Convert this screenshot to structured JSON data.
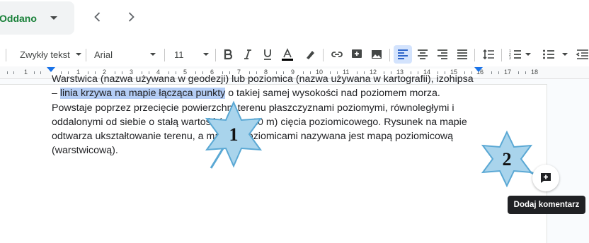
{
  "header": {
    "status_label": "Oddano"
  },
  "toolbar": {
    "style_label": "Zwykły tekst",
    "font_label": "Arial",
    "size_label": "11"
  },
  "ruler": {
    "numbers": [
      "1",
      "1",
      "2",
      "3",
      "4",
      "5",
      "6",
      "7",
      "8",
      "9",
      "10",
      "11",
      "12",
      "13",
      "14",
      "15",
      "16",
      "17",
      "18"
    ]
  },
  "document": {
    "text_before": "Warstwica (nazwa używana w geodezji) lub poziomica (nazwa używana w kartografii), izohipsa – ",
    "highlighted": "linia krzywa na mapie łącząca punkty",
    "text_after": " o takiej samej wysokości nad poziomem morza. Powstaje poprzez przecięcie powierzchni terenu płaszczyznami poziomymi, równoległymi i oddalonymi od siebie o stałą wartość (np. co 10 m) cięcia poziomicowego. Rysunek na mapie odtwarza ukształtowanie terenu, a mapa z poziomicami nazywana jest mapą poziomicową (warstwicową)."
  },
  "comment": {
    "tooltip": "Dodaj komentarz"
  },
  "callouts": {
    "first": "1",
    "second": "2",
    "fill": "#a9d4ec",
    "stroke": "#5aa8d4"
  }
}
